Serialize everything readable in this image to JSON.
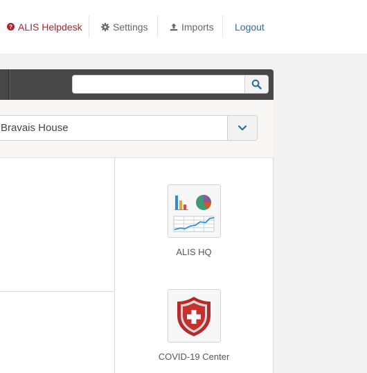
{
  "nav": {
    "helpdesk": "ALIS Helpdesk",
    "settings": "Settings",
    "imports": "Imports",
    "logout": "Logout"
  },
  "search": {
    "placeholder": ""
  },
  "community_select": {
    "selected": "Bravais House"
  },
  "apps": [
    {
      "label": "ALIS HQ",
      "icon": "analytics-dashboard-icon"
    },
    {
      "label": "COVID-19 Center",
      "icon": "medical-shield-icon"
    }
  ],
  "colors": {
    "brand_red": "#a8252f",
    "link_blue": "#2a6f98",
    "header_dark": "#474747"
  }
}
